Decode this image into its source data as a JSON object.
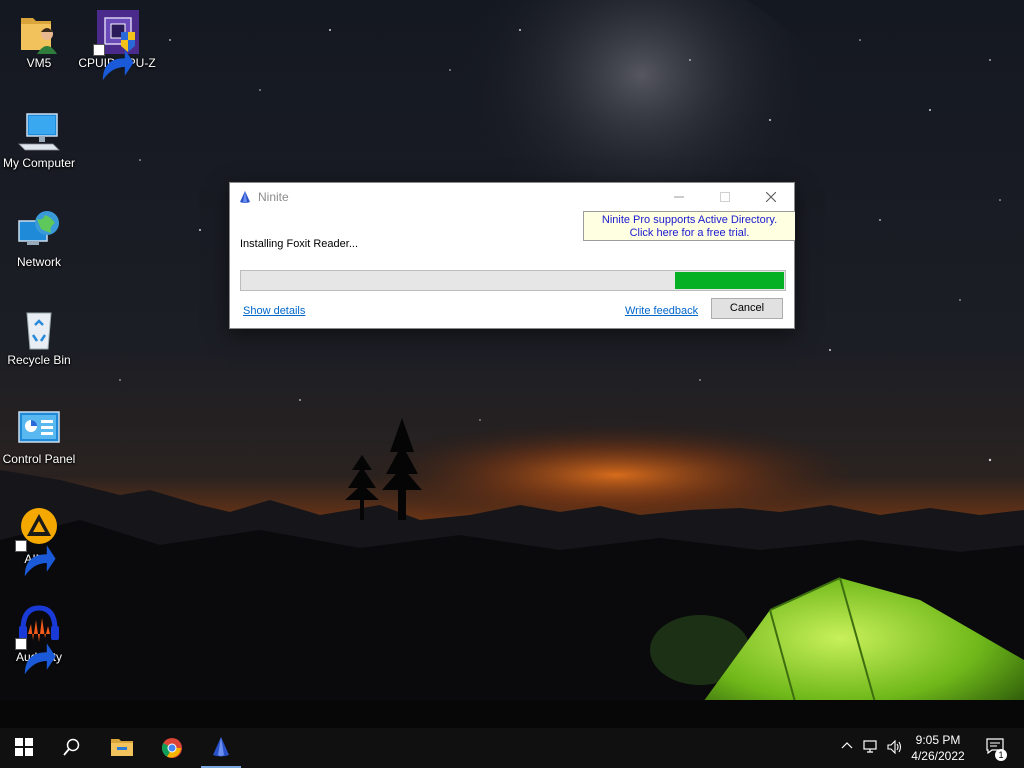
{
  "desktop": {
    "icons": [
      {
        "label": "VM5",
        "icon": "folder-user-icon"
      },
      {
        "label": "CPUID CPU-Z",
        "icon": "cpu-z-icon"
      },
      {
        "label": "My Computer",
        "icon": "computer-icon"
      },
      {
        "label": "Network",
        "icon": "network-icon"
      },
      {
        "label": "Recycle Bin",
        "icon": "recycle-bin-icon"
      },
      {
        "label": "Control Panel",
        "icon": "control-panel-icon"
      },
      {
        "label": "AIMP",
        "icon": "aimp-icon"
      },
      {
        "label": "Audacity",
        "icon": "audacity-icon"
      }
    ]
  },
  "ninite": {
    "title": "Ninite",
    "promo_line1": "Ninite Pro supports Active Directory.",
    "promo_line2": "Click here for a free trial.",
    "status": "Installing Foxit Reader...",
    "progress_fraction": 0.2,
    "show_details": "Show details",
    "write_feedback": "Write feedback",
    "cancel": "Cancel",
    "progress_color": "#06b025"
  },
  "taskbar": {
    "items": [
      "start-icon",
      "search-icon",
      "file-explorer-icon",
      "chrome-icon",
      "ninite-icon"
    ],
    "tray": [
      "chevron-up-icon",
      "network-icon",
      "volume-icon"
    ],
    "time": "9:05 PM",
    "date": "4/26/2022",
    "notification_count": "1"
  }
}
